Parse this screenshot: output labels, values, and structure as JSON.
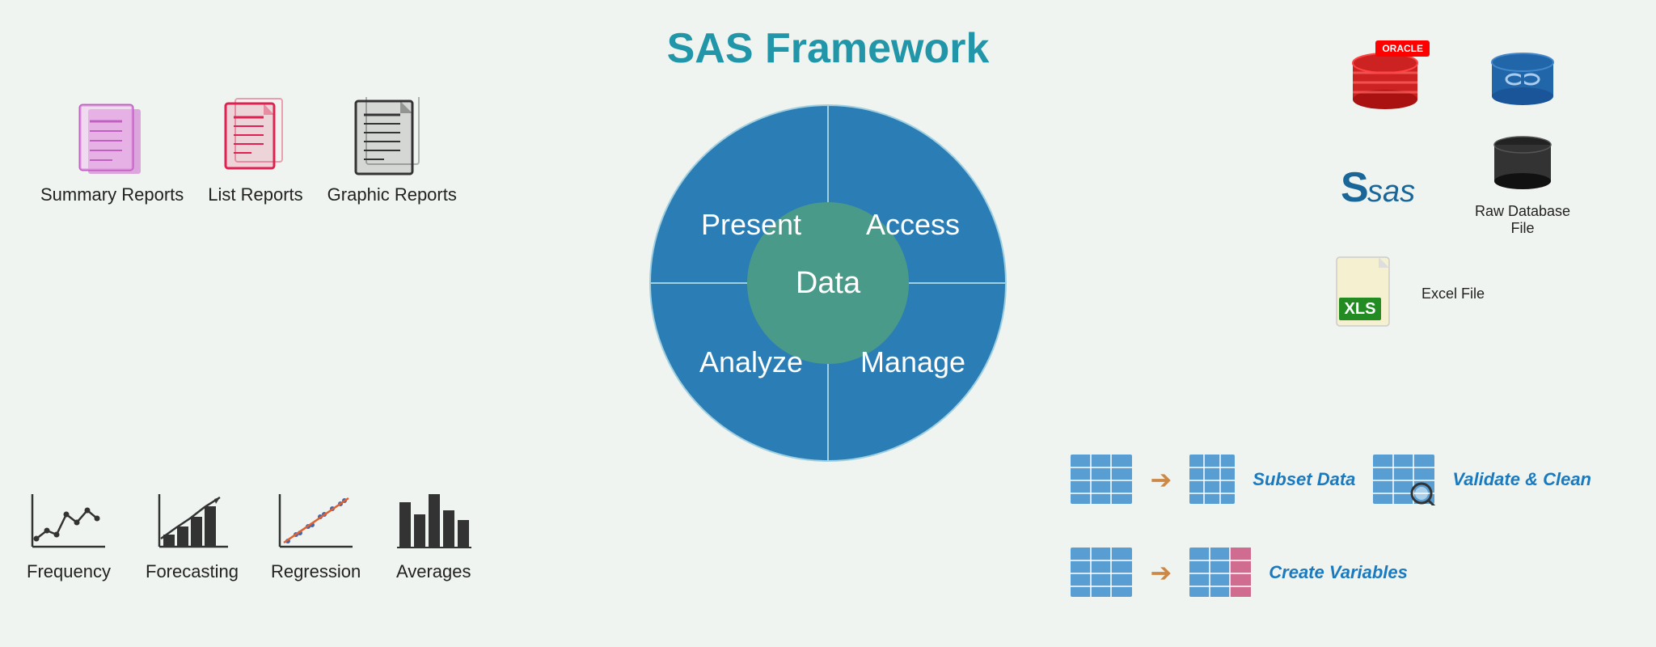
{
  "title": "SAS Framework",
  "wheel": {
    "segments": [
      {
        "label": "Present",
        "angle_start": 180,
        "angle_end": 270
      },
      {
        "label": "Access",
        "angle_start": 270,
        "angle_end": 360
      },
      {
        "label": "Manage",
        "angle_start": 0,
        "angle_end": 90
      },
      {
        "label": "Analyze",
        "angle_start": 90,
        "angle_end": 180
      }
    ],
    "center_label": "Data",
    "outer_color": "#2a7db5",
    "inner_color": "#2a7db5",
    "center_color": "#4a9a8a",
    "line_color": "#5ab0c8"
  },
  "left_reports": [
    {
      "label": "Summary\nReports",
      "type": "summary"
    },
    {
      "label": "List Reports",
      "type": "list"
    },
    {
      "label": "Graphic Reports",
      "type": "graphic"
    }
  ],
  "left_analysis": [
    {
      "label": "Frequency",
      "type": "frequency"
    },
    {
      "label": "Forecasting",
      "type": "forecasting"
    },
    {
      "label": "Regression",
      "type": "regression"
    },
    {
      "label": "Averages",
      "type": "averages"
    }
  ],
  "right_databases": [
    {
      "label": "Oracle DB",
      "type": "oracle",
      "has_badge": true
    },
    {
      "label": "Chain DB",
      "type": "chain"
    },
    {
      "label": "SAS",
      "type": "sas"
    },
    {
      "label": "Raw Database\nFile",
      "type": "raw_db"
    },
    {
      "label": "Excel File",
      "type": "excel",
      "span": "full"
    }
  ],
  "right_manage": [
    {
      "label": "Subset Data",
      "type": "subset"
    },
    {
      "label": "Create Variables",
      "type": "create_vars"
    },
    {
      "label": "Validate & Clean",
      "type": "validate",
      "has_magnify": true
    }
  ]
}
